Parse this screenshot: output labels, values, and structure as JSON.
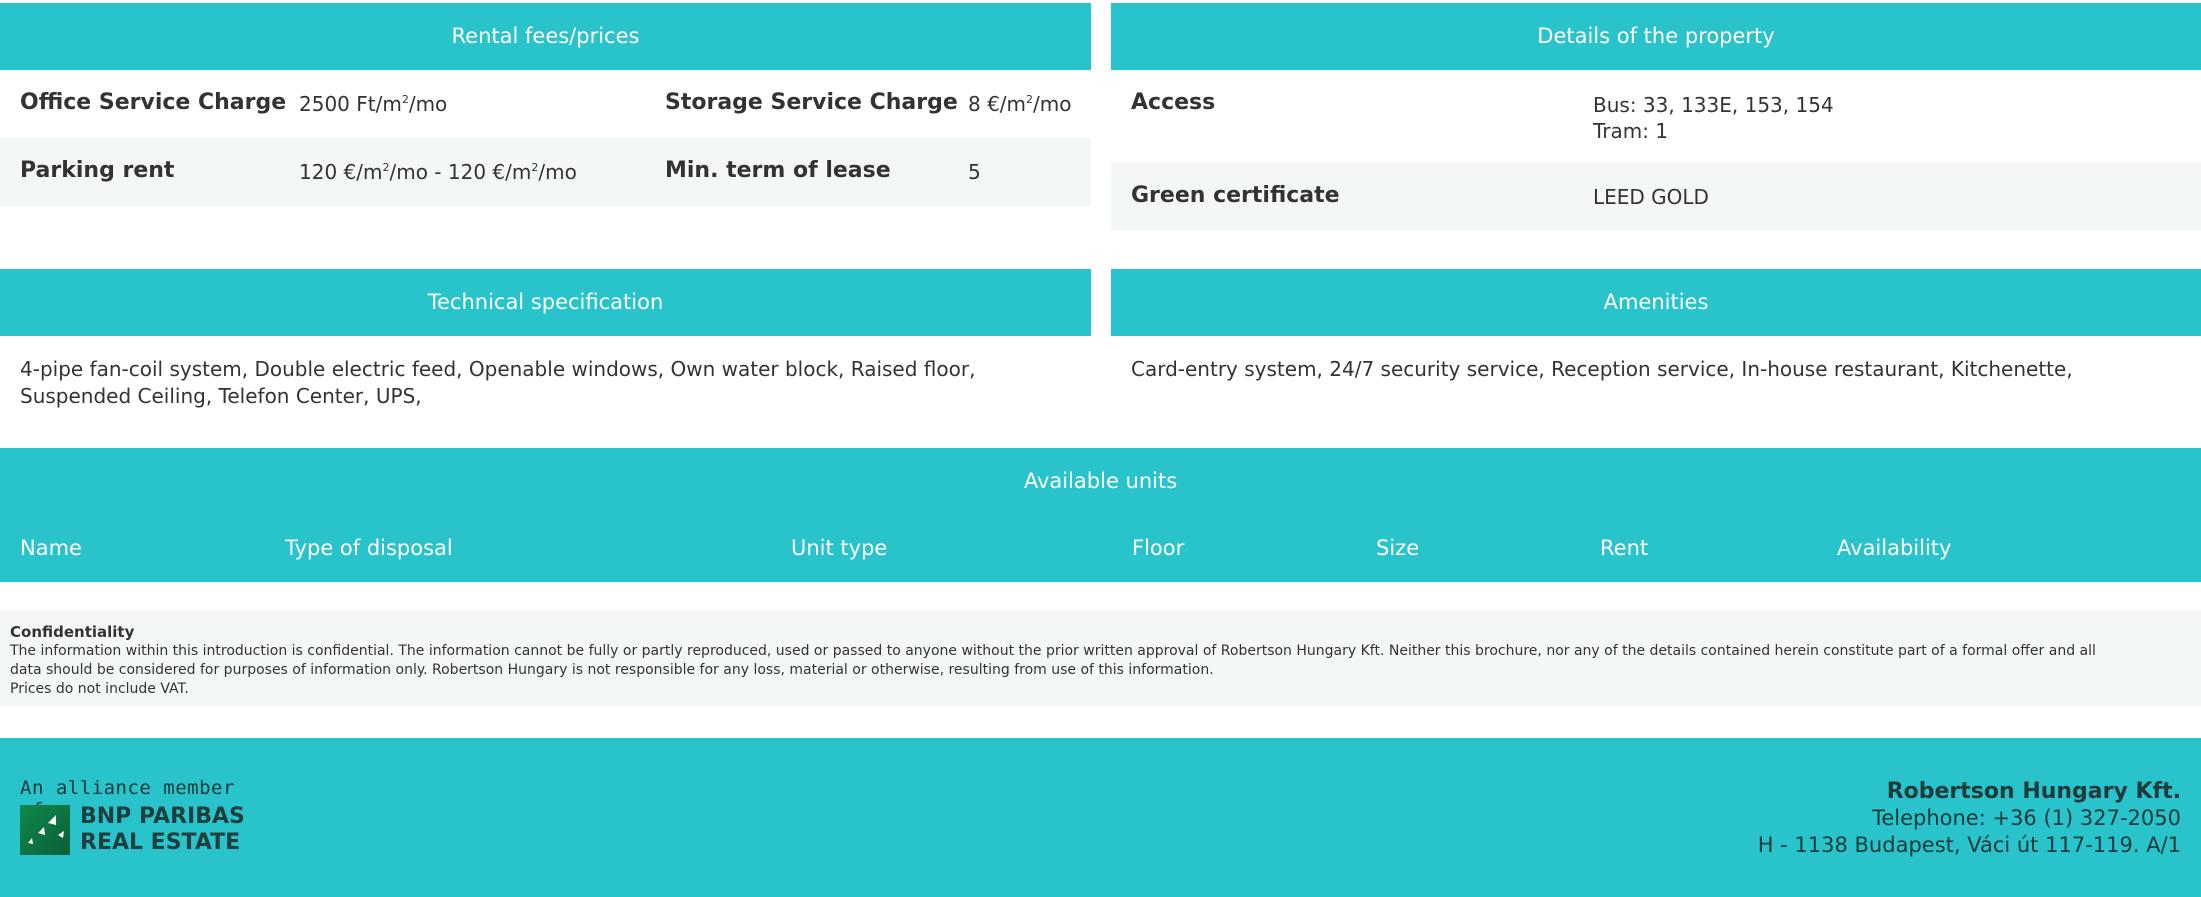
{
  "rental": {
    "title": "Rental fees/prices",
    "office_label": "Office Service Charge",
    "office_value_pre": "2500 Ft/m",
    "office_value_post": "/mo",
    "storage_label": "Storage Service Charge",
    "storage_value_pre": "8 €/m",
    "storage_value_post": "/mo",
    "parking_label": "Parking rent",
    "parking_value_a": "120 €/m",
    "parking_value_b": "/mo - 120 €/m",
    "parking_value_c": "/mo",
    "min_term_label": "Min. term of lease",
    "min_term_value": "5",
    "sup": "2"
  },
  "details": {
    "title": "Details of the property",
    "access_label": "Access",
    "access_line1": "Bus: 33, 133E, 153, 154",
    "access_line2": "Tram: 1",
    "green_label": "Green certificate",
    "green_value": "LEED GOLD"
  },
  "technical": {
    "title": "Technical specification",
    "text_line1": "4-pipe fan-coil system, Double electric feed, Openable windows, Own water block, Raised floor,",
    "text_line2": "Suspended Ceiling, Telefon Center, UPS,"
  },
  "amenities": {
    "title": "Amenities",
    "text": "Card-entry system, 24/7 security service, Reception service, In-house restaurant, Kitchenette,"
  },
  "units": {
    "title": "Available units",
    "columns": [
      "Name",
      "Type of disposal",
      "Unit type",
      "Floor",
      "Size",
      "Rent",
      "Availability"
    ]
  },
  "confidentiality": {
    "title": "Confidentiality",
    "line1": "The information within this introduction is confidential. The information cannot be fully or partly reproduced, used or passed to anyone without the prior written approval of Robertson Hungary Kft. Neither this brochure, nor any of the details contained herein constitute part of a formal offer and all",
    "line2": "data should be considered for purposes of information only. Robertson Hungary is not responsible for any loss, material or otherwise, resulting from use of this information.",
    "line3": "Prices do not include VAT."
  },
  "footer": {
    "logo_tagline": "An alliance member of",
    "logo_line1": "BNP PARIBAS",
    "logo_line2": "REAL ESTATE",
    "company": "Robertson Hungary Kft.",
    "telephone": "Telephone: +36 (1) 327-2050",
    "address": "H - 1138 Budapest, Váci út 117-119. A/1"
  },
  "colors": {
    "accent": "#29c3cb",
    "alt_row": "#f4f7f8",
    "text": "#333333"
  }
}
